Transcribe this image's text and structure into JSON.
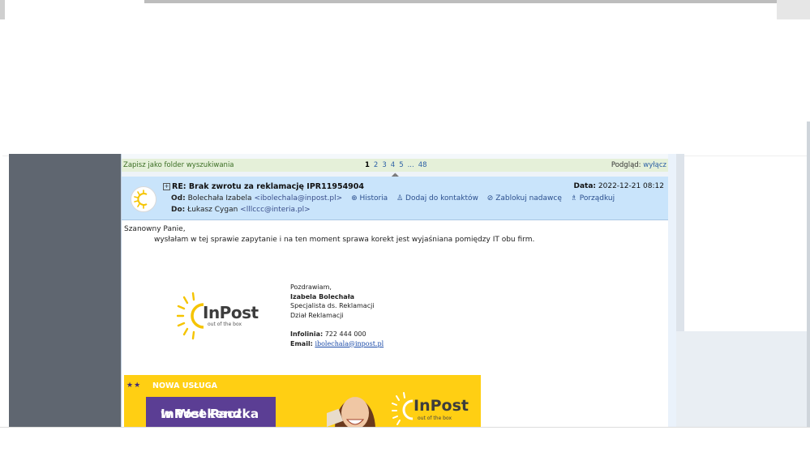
{
  "toolbar": {
    "save_search": "Zapisz jako folder wyszukiwania",
    "pages": [
      "1",
      "2",
      "3",
      "4",
      "5",
      "...",
      "48"
    ],
    "preview_label": "Podgląd:",
    "preview_off": "wyłącz"
  },
  "message": {
    "expand_icon": "plus-box-icon",
    "subject": "RE: Brak zwrotu za reklamację IPR11954904",
    "date_label": "Data:",
    "date_value": "2022-12-21 08:12",
    "from_label": "Od:",
    "from_name": "Bolechała Izabela",
    "from_email": "<ibolechala@inpost.pl>",
    "actions": [
      "Historia",
      "Dodaj do kontaktów",
      "Zablokuj nadawcę",
      "Porządkuj"
    ],
    "action_icons": [
      "history-icon",
      "add-contact-icon",
      "block-icon",
      "sort-icon"
    ],
    "to_label": "Do:",
    "to_name": "Łukasz Cygan",
    "to_email": "<lllccc@interia.pl>"
  },
  "body": {
    "greeting": "Szanowny Panie,",
    "paragraph": "wysłałam w tej sprawie zapytanie i na ten moment sprawa korekt jest wyjaśniana pomiędzy IT obu firm.",
    "logo_text": "InPost",
    "logo_tagline": "out of the box",
    "signature": {
      "closing": "Pozdrawiam,",
      "name": "Izabela Bolechała",
      "title": "Specjalista ds. Reklamacji",
      "department": "Dział Reklamacji",
      "phone_label": "Infolinia:",
      "phone": "722 444 000",
      "email_label": "Email:",
      "email": "ibolechala@inpost.pl"
    },
    "banner": {
      "stars": "★★",
      "tag": "NOWA USŁUGA",
      "headline_1": "InPost Paczka",
      "headline_2": "w Weekend",
      "logo_text": "InPost",
      "logo_tagline": "out of the box"
    }
  },
  "colors": {
    "header_bg": "#c9e4fb",
    "toolbar_bg": "#e5f0d9",
    "banner_yellow": "#ffcf13",
    "banner_purple": "#5b3e94",
    "inpost_yellow": "#f5c400",
    "left_panel": "#5f6670"
  }
}
